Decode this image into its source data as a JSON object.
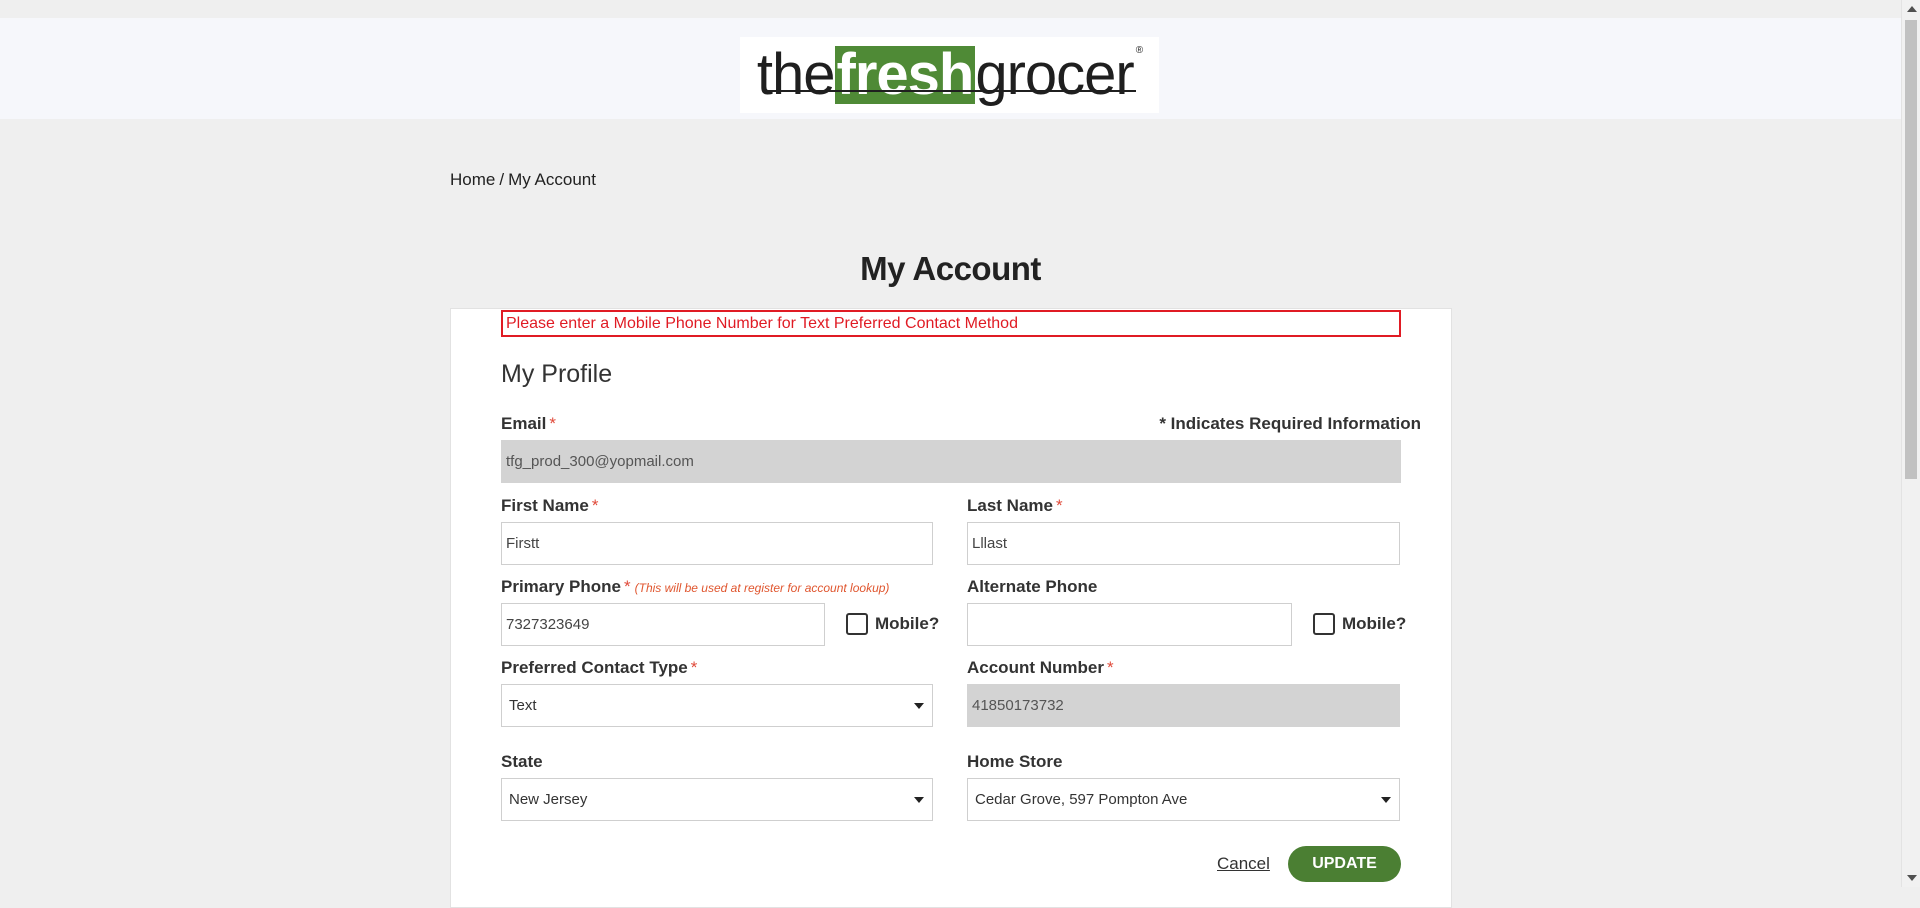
{
  "brand": {
    "logo_parts": [
      "the",
      "fresh",
      "grocer"
    ],
    "logo_reg": "®",
    "fresh_color": "#4f8a36"
  },
  "breadcrumb": {
    "home": "Home",
    "separator": "/",
    "current": "My Account"
  },
  "page_title": "My Account",
  "error_message": "Please enter a Mobile Phone Number for Text Preferred Contact Method",
  "section_title": "My Profile",
  "required_note": "* Indicates Required Information",
  "required_mark": "*",
  "fields": {
    "email": {
      "label": "Email",
      "value": "tfg_prod_300@yopmail.com"
    },
    "first_name": {
      "label": "First Name",
      "value": "Firstt"
    },
    "last_name": {
      "label": "Last Name",
      "value": "Lllast"
    },
    "primary_phone": {
      "label": "Primary Phone",
      "hint": "(This will be used at register for account lookup)",
      "value": "7327323649",
      "mobile_label": "Mobile?"
    },
    "alternate_phone": {
      "label": "Alternate Phone",
      "value": "",
      "mobile_label": "Mobile?"
    },
    "preferred_contact": {
      "label": "Preferred Contact Type",
      "selected": "Text"
    },
    "account_number": {
      "label": "Account Number",
      "value": "41850173732"
    },
    "state": {
      "label": "State",
      "selected": "New Jersey"
    },
    "home_store": {
      "label": "Home Store",
      "selected": "Cedar Grove, 597 Pompton Ave"
    }
  },
  "actions": {
    "cancel": "Cancel",
    "update": "UPDATE",
    "update_color": "#4b7f33"
  },
  "colors": {
    "error": "#e01b24",
    "required": "#e04a3a",
    "hint": "#e0562f"
  }
}
